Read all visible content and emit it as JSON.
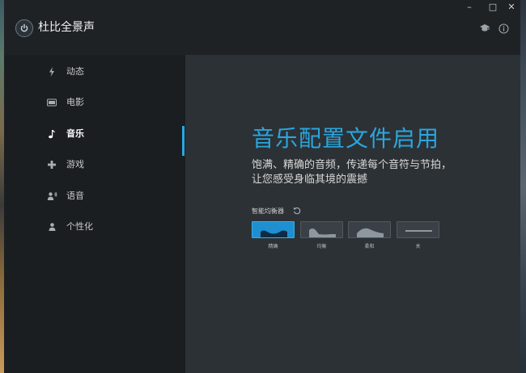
{
  "app": {
    "title": "杜比全景声"
  },
  "window_controls": {
    "minimize": "–",
    "maximize": "□",
    "close": "✕"
  },
  "header_icons": [
    "graduation-cap-icon",
    "info-icon"
  ],
  "sidebar": {
    "items": [
      {
        "label": "动态",
        "icon": "dynamic-icon",
        "active": false
      },
      {
        "label": "电影",
        "icon": "movie-icon",
        "active": false
      },
      {
        "label": "音乐",
        "icon": "music-note-icon",
        "active": true
      },
      {
        "label": "游戏",
        "icon": "gamepad-icon",
        "active": false
      },
      {
        "label": "语音",
        "icon": "voice-icon",
        "active": false
      },
      {
        "label": "个性化",
        "icon": "person-icon",
        "active": false
      }
    ]
  },
  "main": {
    "headline": "音乐配置文件启用",
    "description": "饱满、精确的音频，传递每个音符与节拍，让您感受身临其境的震撼",
    "equalizer": {
      "label": "智能均衡器",
      "options": [
        {
          "label": "精确",
          "selected": true
        },
        {
          "label": "均衡",
          "selected": false
        },
        {
          "label": "柔和",
          "selected": false
        },
        {
          "label": "关",
          "selected": false
        }
      ]
    }
  },
  "colors": {
    "accent": "#29a8e0",
    "sidebar_bg": "#1b1e21",
    "main_bg": "#2c3135"
  }
}
